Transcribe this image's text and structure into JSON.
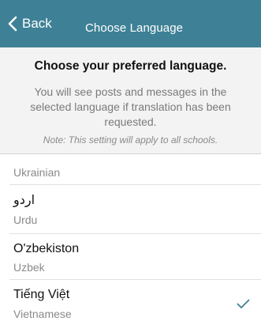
{
  "nav": {
    "back_label": "Back",
    "title": "Choose Language",
    "bar_color": "#3e8196"
  },
  "intro": {
    "heading": "Choose your preferred language.",
    "description": "You will see posts and messages in the selected language if translation has been requested.",
    "note": "Note: This setting will apply to all schools."
  },
  "languages": [
    {
      "native": "",
      "english": "Ukrainian",
      "selected": false
    },
    {
      "native": "اردو",
      "english": "Urdu",
      "selected": false
    },
    {
      "native": "O'zbekiston",
      "english": "Uzbek",
      "selected": false
    },
    {
      "native": "Tiếng Việt",
      "english": "Vietnamese",
      "selected": true,
      "icon": "checkmark-icon"
    }
  ],
  "accent_color": "#3e8196"
}
